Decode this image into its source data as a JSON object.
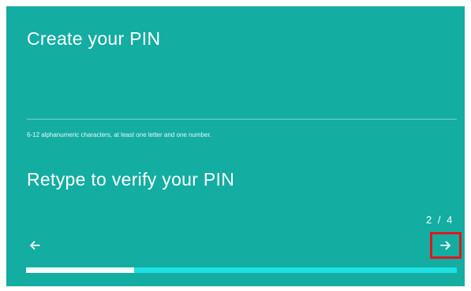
{
  "wizard": {
    "title": "Create your PIN",
    "pin_input_value": "",
    "hint": "6-12 alphanumeric characters, at least one letter and one number.",
    "verify_title": "Retype to verify your PIN",
    "verify_input_value": "",
    "page_indicator": "2 / 4",
    "progress_fraction": 0.25
  },
  "icons": {
    "back": "arrow-left-icon",
    "next": "arrow-right-icon"
  },
  "colors": {
    "background": "#13ada2",
    "progress_track": "#1fe0e3",
    "progress_fill": "#f4fbfb",
    "highlight_border": "#e0171c",
    "text": "#ffffff"
  }
}
